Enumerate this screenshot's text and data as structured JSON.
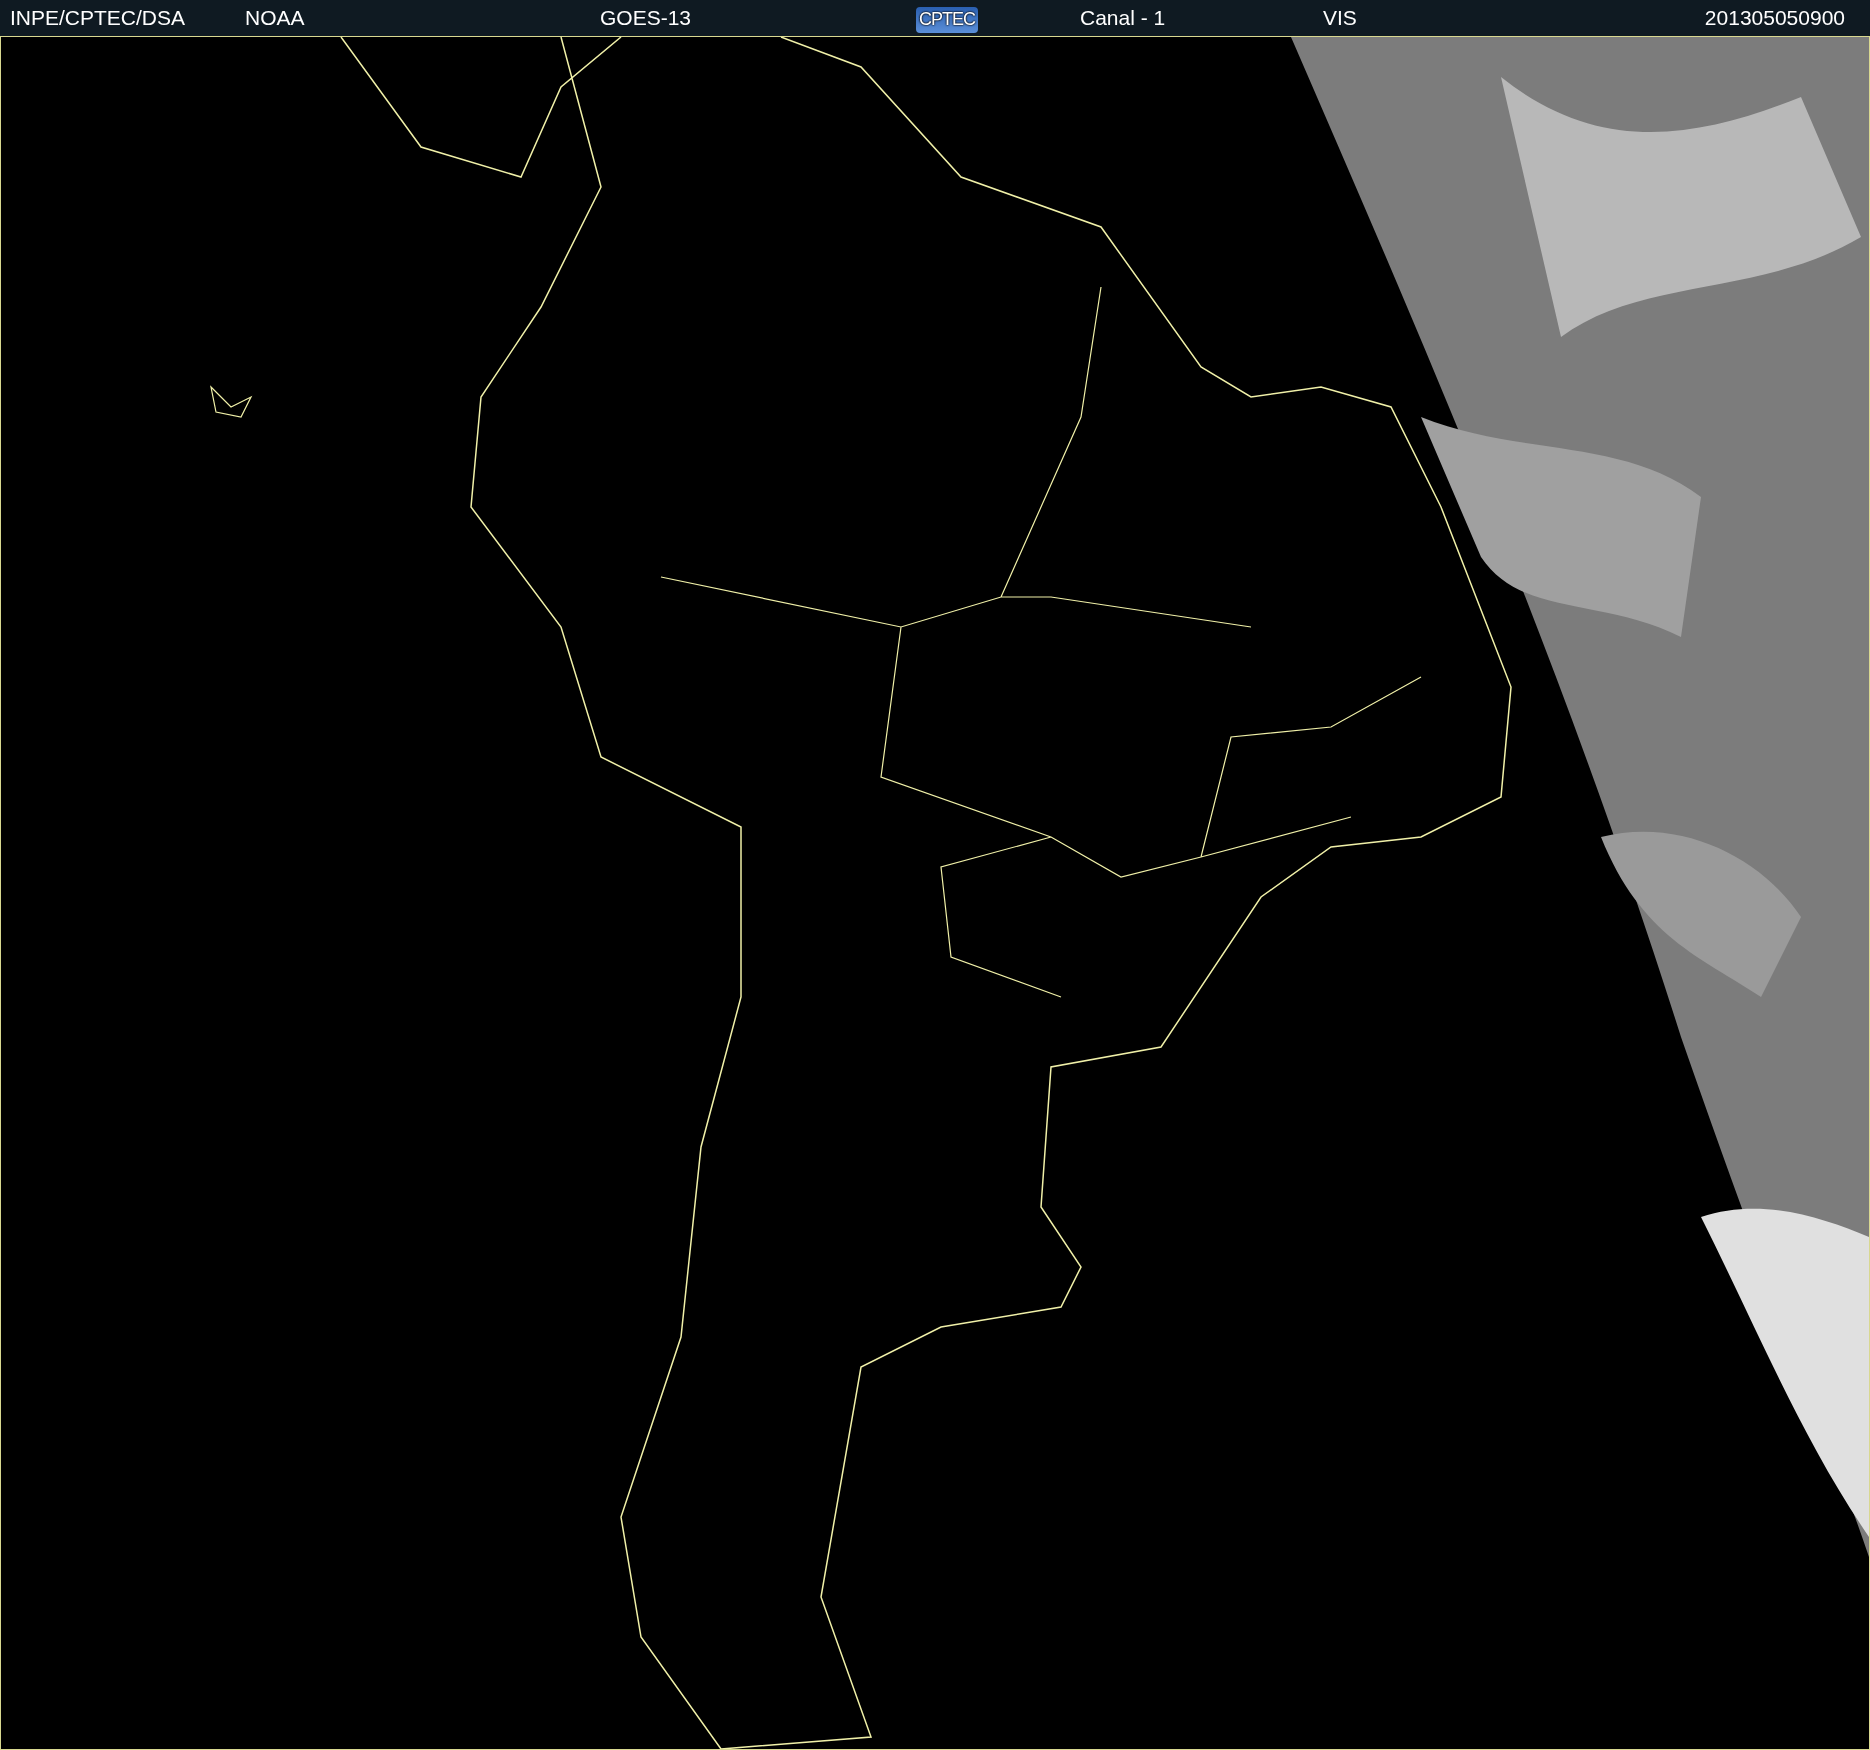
{
  "header": {
    "items": [
      {
        "kind": "text",
        "text": "INPE/CPTEC/DSA"
      },
      {
        "kind": "text",
        "text": "NOAA"
      },
      {
        "kind": "text",
        "text": "GOES-13"
      },
      {
        "kind": "logo",
        "text": "CPTEC"
      },
      {
        "kind": "text",
        "text": "Canal - 1"
      },
      {
        "kind": "text",
        "text": "VIS"
      },
      {
        "kind": "text",
        "text": "201305050900"
      }
    ]
  }
}
